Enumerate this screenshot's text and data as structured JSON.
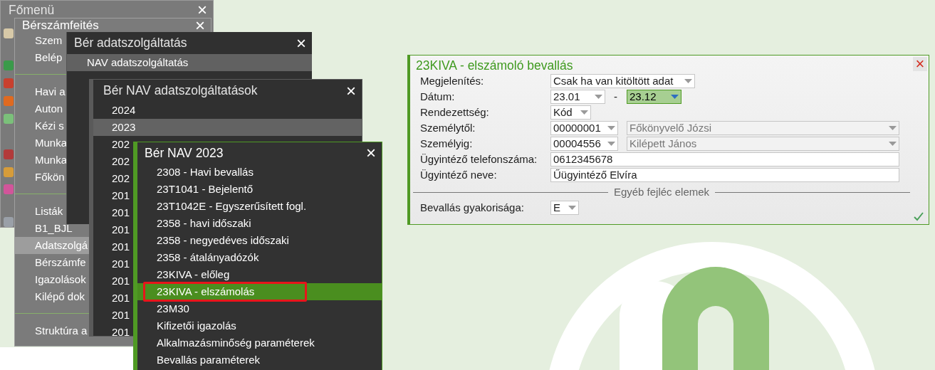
{
  "windows": [
    {
      "kind": "main",
      "title": "Főmenü",
      "close": "×"
    },
    {
      "kind": "grey",
      "title": "Bérszámfeités",
      "close": "×",
      "items": [
        {
          "kind": "item",
          "label": "Szem",
          "selected": false
        },
        {
          "kind": "item",
          "label": "Belép",
          "selected": false
        },
        {
          "kind": "separator"
        },
        {
          "kind": "item",
          "label": "Havi a",
          "selected": false
        },
        {
          "kind": "item",
          "label": "Auton",
          "selected": false
        },
        {
          "kind": "item",
          "label": "Kézi s",
          "selected": false
        },
        {
          "kind": "item",
          "label": "Munka",
          "selected": false
        },
        {
          "kind": "item",
          "label": "Munka",
          "selected": false
        },
        {
          "kind": "item",
          "label": "Főkön",
          "selected": false
        },
        {
          "kind": "separator"
        },
        {
          "kind": "item",
          "label": "Listák",
          "selected": false
        },
        {
          "kind": "item",
          "label": "B1_BJL",
          "selected": false
        },
        {
          "kind": "item",
          "label": "Adatszolgá",
          "selected": true
        },
        {
          "kind": "item",
          "label": "Bérszámfe",
          "selected": false
        },
        {
          "kind": "item",
          "label": "Igazolások",
          "selected": false
        },
        {
          "kind": "item",
          "label": "Kilépő dok",
          "selected": false
        },
        {
          "kind": "separator"
        },
        {
          "kind": "item",
          "label": "Struktúra a",
          "selected": false
        }
      ]
    },
    {
      "kind": "dark",
      "title": "Bér adatszolgáltatás",
      "close": "×",
      "items": [
        {
          "kind": "item",
          "label": "NAV adatszolgáltatás",
          "selected": true
        }
      ]
    },
    {
      "kind": "dark2",
      "title": "Bér NAV adatszolgáltatások",
      "close": "×",
      "items": [
        {
          "kind": "item",
          "label": "2024",
          "selected": false
        },
        {
          "kind": "item",
          "label": "2023",
          "selected": true
        },
        {
          "kind": "item",
          "label": "202",
          "selected": false
        },
        {
          "kind": "item",
          "label": "202",
          "selected": false
        },
        {
          "kind": "item",
          "label": "202",
          "selected": false
        },
        {
          "kind": "item",
          "label": "201",
          "selected": false
        },
        {
          "kind": "item",
          "label": "201",
          "selected": false
        },
        {
          "kind": "item",
          "label": "201",
          "selected": false
        },
        {
          "kind": "item",
          "label": "201",
          "selected": false
        },
        {
          "kind": "item",
          "label": "201",
          "selected": false
        },
        {
          "kind": "item",
          "label": "201",
          "selected": false
        },
        {
          "kind": "item",
          "label": "201",
          "selected": false
        },
        {
          "kind": "item",
          "label": "201",
          "selected": false
        },
        {
          "kind": "item",
          "label": "201",
          "selected": false
        }
      ]
    },
    {
      "kind": "green",
      "title": "Bér NAV 2023",
      "close": "×",
      "items": [
        {
          "kind": "item",
          "label": "2308 - Havi bevallás",
          "selected": false,
          "annotated": false
        },
        {
          "kind": "item",
          "label": "23T1041 - Bejelentő",
          "selected": false,
          "annotated": false
        },
        {
          "kind": "item",
          "label": "23T1042E - Egyszerűsített fogl.",
          "selected": false,
          "annotated": false
        },
        {
          "kind": "item",
          "label": "2358 - havi időszaki",
          "selected": false,
          "annotated": false
        },
        {
          "kind": "item",
          "label": "2358 - negyedéves időszaki",
          "selected": false,
          "annotated": false
        },
        {
          "kind": "item",
          "label": "2358 - átalányadózók",
          "selected": false,
          "annotated": false
        },
        {
          "kind": "item",
          "label": "23KIVA - előleg",
          "selected": false,
          "annotated": false
        },
        {
          "kind": "item",
          "label": "23KIVA - elszámolás",
          "selected": true,
          "annotated": true
        },
        {
          "kind": "item",
          "label": "23M30",
          "selected": false,
          "annotated": false
        },
        {
          "kind": "item",
          "label": "Kifizetői igazolás",
          "selected": false,
          "annotated": false
        },
        {
          "kind": "item",
          "label": "Alkalmazásminőség paraméterek",
          "selected": false,
          "annotated": false
        },
        {
          "kind": "item",
          "label": "Bevallás paraméterek",
          "selected": false,
          "annotated": false
        }
      ]
    }
  ],
  "form": {
    "title": "23KIVA - elszámoló bevallás",
    "close": "×",
    "rows": [
      {
        "kind": "row",
        "label": "Megjelenítés:",
        "controls": [
          {
            "kind": "select",
            "value": "Csak ha van kitöltött adat",
            "focused": false,
            "disabled": false
          }
        ]
      },
      {
        "kind": "row",
        "label": "Dátum:",
        "controls": [
          {
            "kind": "select",
            "value": "23.01",
            "focused": false,
            "disabled": false
          },
          {
            "kind": "dash",
            "value": "-"
          },
          {
            "kind": "select",
            "value": "23.12",
            "focused": true,
            "disabled": false
          }
        ]
      },
      {
        "kind": "row",
        "label": "Rendezettség:",
        "controls": [
          {
            "kind": "select",
            "value": "Kód",
            "focused": false,
            "disabled": false
          }
        ]
      },
      {
        "kind": "row",
        "label": "Személytől:",
        "controls": [
          {
            "kind": "select",
            "value": "00000001",
            "focused": false,
            "disabled": false
          },
          {
            "kind": "select",
            "value": "Főkönyvelő Józsi",
            "focused": false,
            "disabled": true
          }
        ]
      },
      {
        "kind": "row",
        "label": "Személyig:",
        "controls": [
          {
            "kind": "select",
            "value": "00004556",
            "focused": false,
            "disabled": false
          },
          {
            "kind": "select",
            "value": "Kilépett János",
            "focused": false,
            "disabled": true
          }
        ]
      },
      {
        "kind": "row",
        "label": "Ügyintéző telefonszáma:",
        "controls": [
          {
            "kind": "text",
            "value": "0612345678"
          }
        ]
      },
      {
        "kind": "row",
        "label": "Ügyintéző neve:",
        "controls": [
          {
            "kind": "text",
            "value": "Űügyintéző Elvíra"
          }
        ]
      },
      {
        "kind": "section",
        "label": "Egyéb fejléc elemek"
      },
      {
        "kind": "row",
        "label": "Bevallás gyakorisága:",
        "controls": [
          {
            "kind": "select",
            "value": "E",
            "focused": false,
            "disabled": false
          }
        ]
      }
    ]
  }
}
